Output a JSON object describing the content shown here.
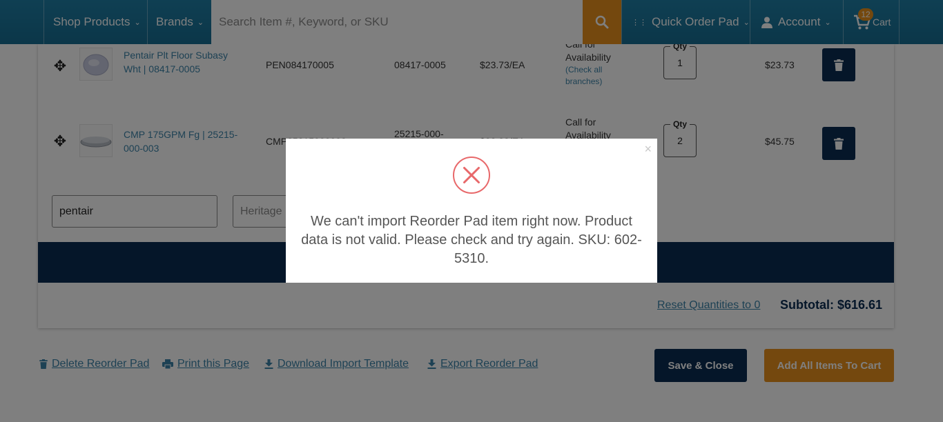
{
  "header": {
    "shop_products": "Shop Products",
    "brands": "Brands",
    "search_placeholder": "Search Item #, Keyword, or SKU",
    "quick_order_pad": "Quick Order Pad",
    "account": "Account",
    "cart_label": "Cart",
    "cart_count": "12"
  },
  "items": [
    {
      "name": "Pentair Plt Floor Subasy Wht | 08417-0005",
      "item_no": "PEN084170005",
      "mfr_no": "08417-0005",
      "price": "$23.73/EA",
      "availability": "Call for Availability",
      "availability_note": "(Check all branches)",
      "qty_label": "Qty",
      "qty": "1",
      "total": "$23.73"
    },
    {
      "name": "CMP 175GPM Fg | 25215-000-003",
      "item_no": "CMP25215000003",
      "mfr_no": "25215-000-",
      "price": "$22.88/EA",
      "availability": "Call for Availability",
      "qty_label": "Qty",
      "qty": "2",
      "total": "$45.75"
    }
  ],
  "filter": {
    "search_value": "pentair",
    "brand_placeholder": "Heritage"
  },
  "footer": {
    "reset_link": "Reset Quantities to 0",
    "subtotal": "Subtotal: $616.61"
  },
  "actions": {
    "delete": "Delete Reorder Pad",
    "print": "Print this Page",
    "download": "Download Import Template",
    "export": "Export Reorder Pad",
    "save_close": "Save & Close",
    "add_all": "Add All Items To Cart"
  },
  "modal": {
    "close": "×",
    "message": "We can't import Reorder Pad item right now. Product data is not valid. Please check and try again. SKU: 602-5310."
  },
  "colors": {
    "header_blue": "#1f7fa6",
    "navy": "#0b2d52",
    "orange": "#e8901c",
    "link_blue": "#3b83a8",
    "error_red": "#e8686a"
  },
  "icons": [
    "chevron-down-icon",
    "search-icon",
    "keypad-icon",
    "user-icon",
    "cart-icon",
    "move-icon",
    "trash-icon",
    "print-icon",
    "download-icon",
    "error-x-icon",
    "close-icon"
  ]
}
